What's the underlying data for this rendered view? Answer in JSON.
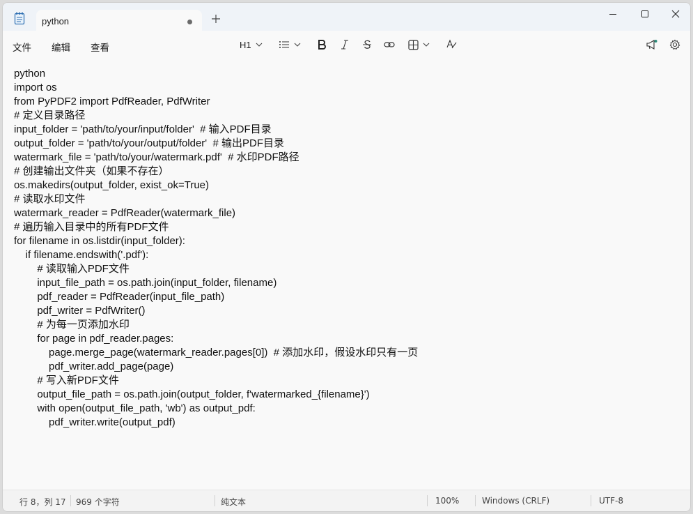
{
  "tab": {
    "title": "python"
  },
  "menu": {
    "file": "文件",
    "edit": "编辑",
    "view": "查看"
  },
  "toolbar": {
    "heading": "H1"
  },
  "editor": {
    "lines": [
      "python",
      "import os",
      "from PyPDF2 import PdfReader, PdfWriter",
      "# 定义目录路径",
      "input_folder = 'path/to/your/input/folder'  # 输入PDF目录",
      "output_folder = 'path/to/your/output/folder'  # 输出PDF目录",
      "watermark_file = 'path/to/your/watermark.pdf'  # 水印PDF路径",
      "# 创建输出文件夹（如果不存在）",
      "os.makedirs(output_folder, exist_ok=True)",
      "# 读取水印文件",
      "watermark_reader = PdfReader(watermark_file)",
      "# 遍历输入目录中的所有PDF文件",
      "for filename in os.listdir(input_folder):",
      "    if filename.endswith('.pdf'):",
      "        # 读取输入PDF文件",
      "        input_file_path = os.path.join(input_folder, filename)",
      "        pdf_reader = PdfReader(input_file_path)",
      "        pdf_writer = PdfWriter()",
      "        # 为每一页添加水印",
      "        for page in pdf_reader.pages:",
      "            page.merge_page(watermark_reader.pages[0])  # 添加水印，假设水印只有一页",
      "            pdf_writer.add_page(page)",
      "        # 写入新PDF文件",
      "        output_file_path = os.path.join(output_folder, f'watermarked_{filename}')",
      "        with open(output_file_path, 'wb') as output_pdf:",
      "            pdf_writer.write(output_pdf)"
    ]
  },
  "status": {
    "position": "行 8，列 17",
    "chars": "969 个字符",
    "format": "纯文本",
    "zoom": "100%",
    "line_ending": "Windows (CRLF)",
    "encoding": "UTF-8"
  },
  "icons": {
    "app": "notepad-icon",
    "new_tab": "plus-icon",
    "minimize": "minimize-icon",
    "maximize": "maximize-icon",
    "close": "close-icon",
    "list": "list-icon",
    "bold": "bold-icon",
    "italic": "italic-icon",
    "strike": "strikethrough-icon",
    "link": "link-icon",
    "table": "table-icon",
    "clear": "clear-format-icon",
    "copilot": "megaphone-icon",
    "settings": "gear-icon"
  },
  "colors": {
    "titlebar": "#eff3f8",
    "accent": "#2a8c7a",
    "text": "#111111"
  }
}
